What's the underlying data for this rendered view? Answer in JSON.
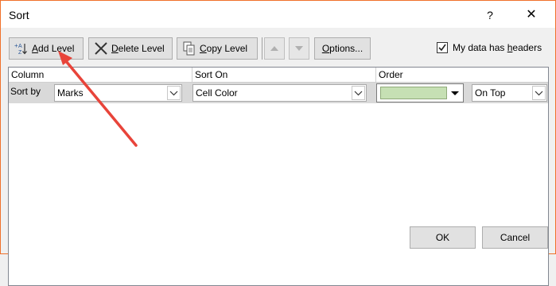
{
  "window": {
    "title": "Sort",
    "help_label": "?",
    "close_label": "✕"
  },
  "toolbar": {
    "add_level": {
      "prefix": "",
      "accel": "A",
      "rest": "dd Level",
      "icon": "add-level-icon"
    },
    "delete_level": {
      "accel": "D",
      "rest": "elete Level",
      "icon": "delete-x-icon"
    },
    "copy_level": {
      "accel": "C",
      "rest": "opy Level",
      "icon": "copy-icon"
    },
    "move_up_icon": "triangle-up-icon",
    "move_down_icon": "triangle-down-icon",
    "options": {
      "accel": "O",
      "rest": "ptions..."
    }
  },
  "headers_checkbox": {
    "checked": true,
    "label_pre": "My data has ",
    "accel": "h",
    "label_post": "eaders"
  },
  "grid": {
    "columns": [
      "Column",
      "Sort On",
      "Order"
    ],
    "row": {
      "label": "Sort by",
      "column_value": "Marks",
      "sort_on_value": "Cell Color",
      "order_color": "#c6e0b4",
      "position_value": "On Top"
    }
  },
  "footer": {
    "ok_label": "OK",
    "cancel_label": "Cancel"
  },
  "annotation": {
    "arrow_color": "#e8443a"
  }
}
